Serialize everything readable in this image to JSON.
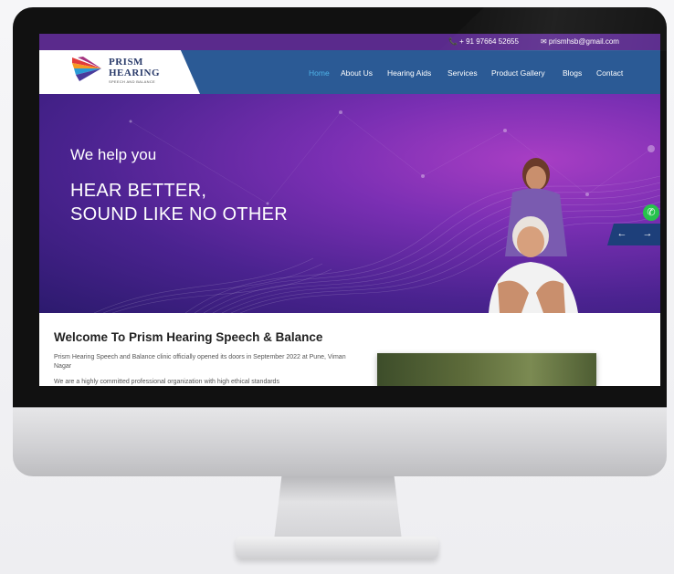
{
  "topbar": {
    "phone": "📞 + 91 97664 52655",
    "email": "✉ prismhsb@gmail.com"
  },
  "logo": {
    "line1": "PRISM",
    "line2": "HEARING",
    "line3": "SPEECH AND BALANCE"
  },
  "nav": {
    "items": [
      {
        "label": "Home",
        "active": true
      },
      {
        "label": "About Us",
        "active": false
      },
      {
        "label": "Hearing Aids",
        "active": false
      },
      {
        "label": "Services",
        "active": false
      },
      {
        "label": "Product Gallery",
        "active": false
      },
      {
        "label": "Blogs",
        "active": false
      },
      {
        "label": "Contact",
        "active": false
      }
    ]
  },
  "hero": {
    "line1": "We help you",
    "line2": "HEAR BETTER,",
    "line3": "SOUND LIKE NO OTHER",
    "prev": "←",
    "next": "→",
    "whatsapp_icon": "whatsapp-icon"
  },
  "welcome": {
    "title": "Welcome To Prism Hearing Speech & Balance",
    "para1": "Prism Hearing Speech and Balance clinic officially opened its doors in September 2022 at Pune, Viman Nagar",
    "para2": "We are a highly committed professional organization with high ethical standards"
  },
  "colors": {
    "topbar": "#5a2a8c",
    "nav": "#2b5a95",
    "active_nav": "#4fb3e8",
    "whatsapp": "#27c24c"
  }
}
